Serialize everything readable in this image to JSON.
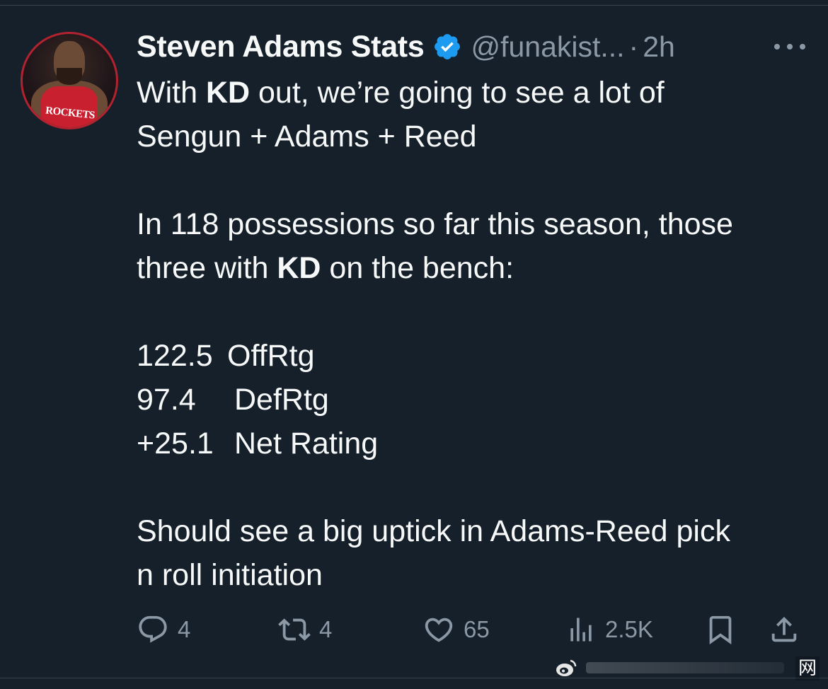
{
  "author": {
    "display_name": "Steven Adams Stats",
    "handle": "@funakist...",
    "separator": "·",
    "time": "2h",
    "avatar_jersey_text": "ROCKETS"
  },
  "tweet": {
    "line1_prefix": "With ",
    "line1_bold": "KD",
    "line1_suffix": " out, we’re going to see a lot of",
    "line2": "Sengun + Adams + Reed",
    "line3": "In 118 possessions so far this season, those",
    "line4_prefix": "three with ",
    "line4_bold": "KD",
    "line4_suffix": " on the bench:",
    "stats": [
      {
        "value": "122.5",
        "label": "OffRtg"
      },
      {
        "value": "97.4",
        "label": "DefRtg"
      },
      {
        "value": "+25.1",
        "label": "Net Rating"
      }
    ],
    "line_final1": "Should see a big uptick in Adams-Reed pick",
    "line_final2": "n roll initiation"
  },
  "actions": {
    "replies": "4",
    "reposts": "4",
    "likes": "65",
    "views": "2.5K"
  },
  "watermark": {
    "char": "网"
  },
  "icons": {
    "verified": "verified-badge-icon",
    "more": "more-icon",
    "reply": "reply-icon",
    "repost": "repost-icon",
    "like": "heart-icon",
    "views": "views-icon",
    "bookmark": "bookmark-icon",
    "share": "share-icon"
  },
  "colors": {
    "background": "#15202b",
    "text": "#f7f9f9",
    "muted": "#8b98a5",
    "verified": "#1d9bf0",
    "avatar_ring": "#b3222f"
  }
}
